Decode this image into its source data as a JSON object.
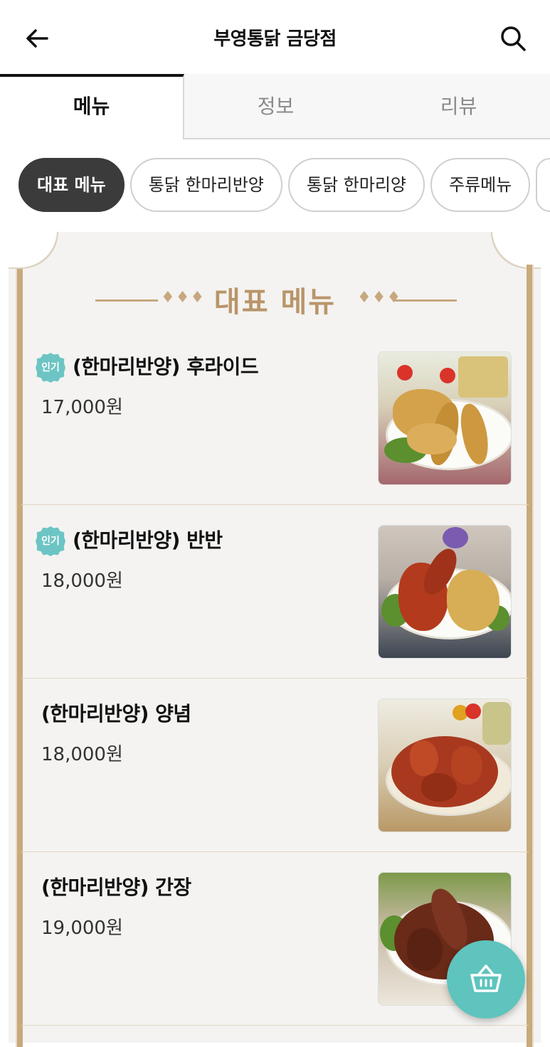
{
  "header": {
    "title": "부영통닭 금당점"
  },
  "tabs": [
    {
      "label": "메뉴",
      "active": true
    },
    {
      "label": "정보",
      "active": false
    },
    {
      "label": "리뷰",
      "active": false
    }
  ],
  "categories": [
    {
      "label": "대표 메뉴",
      "active": true
    },
    {
      "label": "통닭 한마리반양",
      "active": false
    },
    {
      "label": "통닭 한마리양",
      "active": false
    },
    {
      "label": "주류메뉴",
      "active": false
    }
  ],
  "section": {
    "title": "대표 메뉴"
  },
  "badge_label": "인기",
  "menu_items": [
    {
      "name": "(한마리반양) 후라이드",
      "price": "17,000원",
      "popular": true
    },
    {
      "name": "(한마리반양) 반반",
      "price": "18,000원",
      "popular": true
    },
    {
      "name": "(한마리반양) 양념",
      "price": "18,000원",
      "popular": false
    },
    {
      "name": "(한마리반양) 간장",
      "price": "19,000원",
      "popular": false
    }
  ],
  "colors": {
    "accent_gold": "#b9956a",
    "badge_teal": "#6cc5c4",
    "cart_teal": "#5ec4bd"
  }
}
